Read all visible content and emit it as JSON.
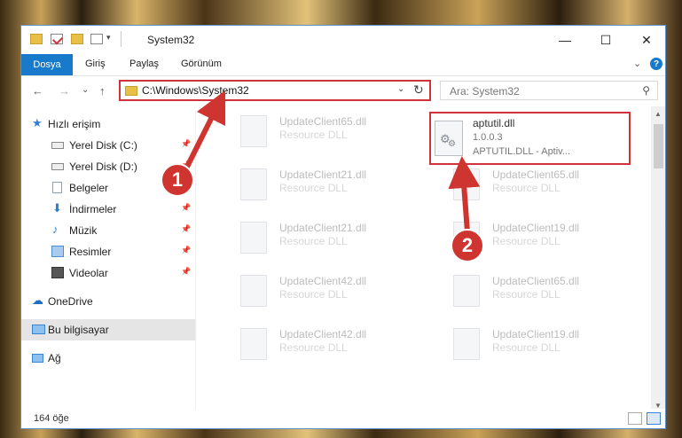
{
  "window": {
    "title": "System32",
    "controls": {
      "minimize": "—",
      "maximize": "☐",
      "close": "✕"
    }
  },
  "ribbon": {
    "tabs": [
      "Dosya",
      "Giriş",
      "Paylaş",
      "Görünüm"
    ],
    "help": "?",
    "expand": "⌄"
  },
  "nav": {
    "back": "←",
    "forward": "→",
    "recent": "⌄",
    "up": "↑",
    "address": "C:\\Windows\\System32",
    "address_dropdown": "⌄",
    "refresh": "↻",
    "search_placeholder": "Ara: System32",
    "search_icon": "⚲"
  },
  "sidebar": {
    "items": [
      {
        "label": "Hızlı erişim",
        "icon": "star-icon",
        "color": "#2d7fd3"
      },
      {
        "label": "Yerel Disk (C:)",
        "icon": "drive-icon",
        "color": "#6b6b6b"
      },
      {
        "label": "Yerel Disk (D:)",
        "icon": "drive-icon",
        "color": "#6b6b6b"
      },
      {
        "label": "Belgeler",
        "icon": "document-icon",
        "color": "#8aa3bd"
      },
      {
        "label": "İndirmeler",
        "icon": "download-icon",
        "color": "#2d7fd3"
      },
      {
        "label": "Müzik",
        "icon": "music-icon",
        "color": "#2d7fd3"
      },
      {
        "label": "Resimler",
        "icon": "pictures-icon",
        "color": "#4a8fd0"
      },
      {
        "label": "Videolar",
        "icon": "video-icon",
        "color": "#555"
      },
      {
        "label": "OneDrive",
        "icon": "cloud-icon",
        "color": "#1d6fc6"
      },
      {
        "label": "Bu bilgisayar",
        "icon": "computer-icon",
        "color": "#3a84d0"
      },
      {
        "label": "Ağ",
        "icon": "network-icon",
        "color": "#3a84d0"
      }
    ],
    "pin": "📌"
  },
  "files": {
    "left_column": [
      {
        "name": "UpdateClient65.dll",
        "desc": "Resource DLL"
      },
      {
        "name": "UpdateClient21.dll",
        "desc": "Resource DLL"
      },
      {
        "name": "UpdateClient21.dll",
        "desc": "Resource DLL"
      },
      {
        "name": "UpdateClient42.dll",
        "desc": "Resource DLL"
      },
      {
        "name": "UpdateClient42.dll",
        "desc": "Resource DLL"
      }
    ],
    "right_column": [
      {
        "name": "UpdateClient65.dll",
        "desc": "Resource DLL"
      },
      {
        "name": "UpdateClient19.dll",
        "desc": "Resource DLL"
      },
      {
        "name": "UpdateClient65.dll",
        "desc": "Resource DLL"
      },
      {
        "name": "UpdateClient19.dll",
        "desc": "Resource DLL"
      }
    ],
    "highlighted": {
      "name": "aptutil.dll",
      "version": "1.0.0.3",
      "desc": "APTUTIL.DLL - Aptiv..."
    }
  },
  "status": {
    "count": "164 öğe"
  },
  "callouts": [
    "1",
    "2"
  ],
  "colors": {
    "accent": "#1979ca",
    "highlight": "#d0343a",
    "callout": "#cf3530"
  }
}
